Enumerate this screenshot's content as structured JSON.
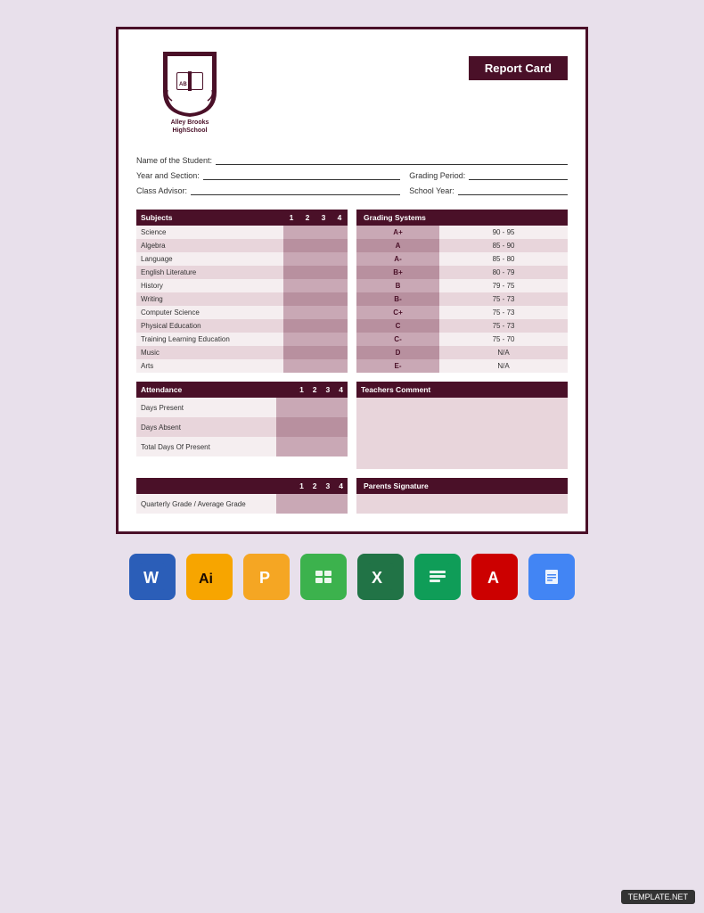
{
  "header": {
    "school_name": "Alley Brooks\nHighSchool",
    "report_card_title": "Report Card"
  },
  "student_info": {
    "name_label": "Name of the Student:",
    "year_label": "Year and Section:",
    "class_label": "Class Advisor:",
    "grading_label": "Grading Period:",
    "school_year_label": "School Year:"
  },
  "subjects_table": {
    "header": "Subjects",
    "quarters": [
      "1",
      "2",
      "3",
      "4"
    ],
    "rows": [
      "Science",
      "Algebra",
      "Language",
      "English Literature",
      "History",
      "Writing",
      "Computer Science",
      "Physical Education",
      "Training Learning Education",
      "Music",
      "Arts"
    ]
  },
  "grading_table": {
    "header": "Grading Systems",
    "rows": [
      {
        "grade": "A+",
        "range": "90 - 95"
      },
      {
        "grade": "A",
        "range": "85 - 90"
      },
      {
        "grade": "A-",
        "range": "85 - 80"
      },
      {
        "grade": "B+",
        "range": "80 - 79"
      },
      {
        "grade": "B",
        "range": "79 - 75"
      },
      {
        "grade": "B-",
        "range": "75 - 73"
      },
      {
        "grade": "C+",
        "range": "75 - 73"
      },
      {
        "grade": "C",
        "range": "75 - 73"
      },
      {
        "grade": "C-",
        "range": "75 - 70"
      },
      {
        "grade": "D",
        "range": "N/A"
      },
      {
        "grade": "E-",
        "range": "N/A"
      }
    ]
  },
  "attendance": {
    "header": "Attendance",
    "quarters": [
      "1",
      "2",
      "3",
      "4"
    ],
    "rows": [
      "Days Present",
      "Days Absent",
      "Total Days Of Present"
    ]
  },
  "teachers_comment": {
    "label": "Teachers Comment"
  },
  "quarterly": {
    "quarters": [
      "1",
      "2",
      "3",
      "4"
    ],
    "row_label": "Quarterly Grade / Average Grade"
  },
  "parents_signature": {
    "label": "Parents Signature"
  },
  "app_icons": [
    {
      "name": "word",
      "label": "W",
      "class": "icon-word"
    },
    {
      "name": "illustrator",
      "label": "Ai",
      "class": "icon-ai"
    },
    {
      "name": "pages",
      "label": "P",
      "class": "icon-pages"
    },
    {
      "name": "numbers",
      "label": "N",
      "class": "icon-numbers"
    },
    {
      "name": "excel",
      "label": "X",
      "class": "icon-excel"
    },
    {
      "name": "sheets",
      "label": "S",
      "class": "icon-sheets"
    },
    {
      "name": "acrobat",
      "label": "A",
      "class": "icon-acrobat"
    },
    {
      "name": "docs",
      "label": "D",
      "class": "icon-docs"
    }
  ],
  "template_badge": "TEMPLATE.NET"
}
